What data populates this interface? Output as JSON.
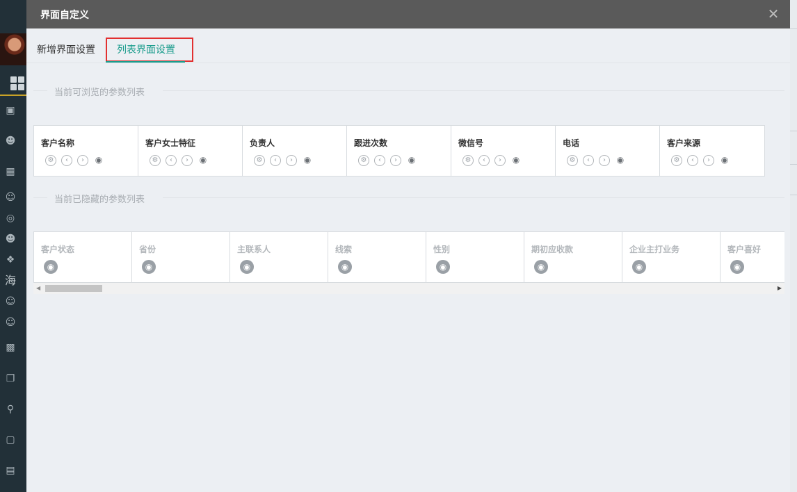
{
  "modal": {
    "title": "界面自定义",
    "close_icon": "close-icon"
  },
  "tabs": [
    {
      "label": "新增界面设置",
      "active": false
    },
    {
      "label": "列表界面设置",
      "active": true
    }
  ],
  "sections": {
    "visible_title": "当前可浏览的参数列表",
    "hidden_title": "当前已隐藏的参数列表"
  },
  "visible_fields": [
    "客户名称",
    "客户女士特征",
    "负责人",
    "跟进次数",
    "微信号",
    "电话",
    "客户来源"
  ],
  "hidden_fields": [
    "客户状态",
    "省份",
    "主联系人",
    "线索",
    "性别",
    "期初应收款",
    "企业主打业务",
    "客户喜好"
  ],
  "sidebar": {
    "sea_label": "海"
  },
  "colors": {
    "accent": "#1a9c8c",
    "highlight": "#e23030",
    "header_bg": "#5a5a5a"
  }
}
